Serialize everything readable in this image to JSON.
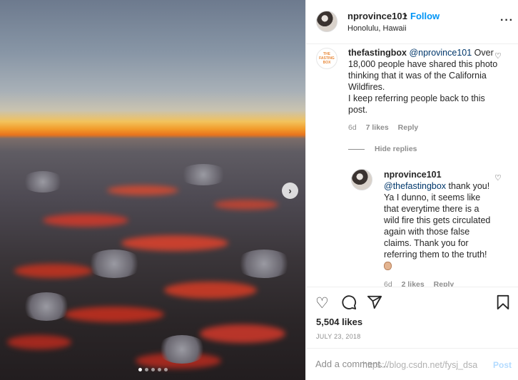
{
  "header": {
    "username": "nprovince101",
    "separator": "•",
    "follow_label": "Follow",
    "location": "Honolulu, Hawaii",
    "more_icon": "more-horizontal-icon"
  },
  "comments": [
    {
      "username": "thefastingbox",
      "mention": "@nprovince101",
      "text": "Over 18,000 people have shared this photo thinking that it was of the California Wildfires.\nI keep referring people back to this post.",
      "time": "6d",
      "likes": "7 likes",
      "reply_label": "Reply",
      "avatar_text": "THE FASTING BOX"
    }
  ],
  "hide_replies_label": "Hide replies",
  "reply": {
    "username": "nprovince101",
    "mention": "@thefastingbox",
    "text": "thank you! Ya I dunno, it seems like that everytime there is a wild fire this gets circulated again with those false claims. Thank you for referring them to the truth!",
    "time": "6d",
    "likes": "2 likes",
    "reply_label": "Reply"
  },
  "post": {
    "likes": "5,504 likes",
    "date": "JULY 23, 2018"
  },
  "add_comment": {
    "placeholder": "Add a comment...",
    "post_label": "Post"
  },
  "watermark": "https://blog.csdn.net/fysj_dsa",
  "carousel": {
    "count": 5,
    "active": 1
  },
  "colors": {
    "link_blue": "#0095f6",
    "text": "#262626",
    "muted": "#8e8e8e",
    "post_disabled": "#b3dbff"
  }
}
